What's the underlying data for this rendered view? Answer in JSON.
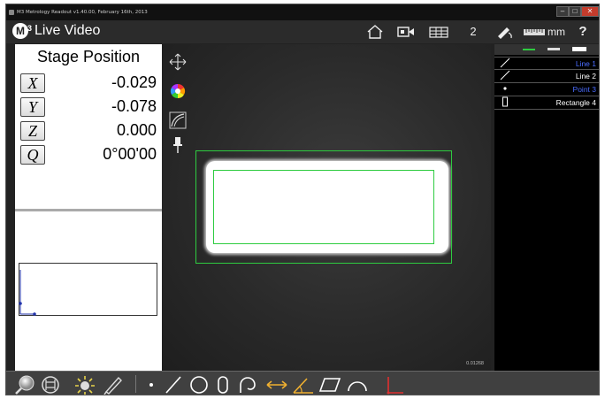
{
  "window": {
    "title": "M3 Metrology Readout  v1.40.00, February 16th, 2013",
    "min_label": "–",
    "max_label": "□",
    "close_label": "✕"
  },
  "app": {
    "logo": "M",
    "logo_sup": "3",
    "title": "Live Video"
  },
  "toolbar": {
    "home_icon": "home-icon",
    "camera_icon": "video-camera-icon",
    "grid_icon": "grid-icon",
    "count": "2",
    "probe_icon": "probe-icon",
    "units": "mm",
    "help": "?"
  },
  "stage": {
    "title": "Stage Position",
    "axes": [
      {
        "label": "X",
        "value": "-0.029"
      },
      {
        "label": "Y",
        "value": "-0.078"
      },
      {
        "label": "Z",
        "value": "0.000"
      },
      {
        "label": "Q",
        "value": "0°00'00"
      }
    ]
  },
  "video": {
    "coord_readout": "0.01268"
  },
  "features": {
    "items": [
      {
        "icon": "line-icon",
        "label": "Line 1",
        "color": "#4a6cff"
      },
      {
        "icon": "line-icon",
        "label": "Line 2",
        "color": "#ffffff"
      },
      {
        "icon": "point-icon",
        "label": "Point 3",
        "color": "#4a6cff"
      },
      {
        "icon": "rectangle-icon",
        "label": "Rectangle 4",
        "color": "#ffffff"
      }
    ]
  },
  "colors": {
    "accent_green": "#2ecc40",
    "highlight_blue": "#4a6cff",
    "tool_orange": "#f0b030",
    "axis_red": "#e03030"
  }
}
